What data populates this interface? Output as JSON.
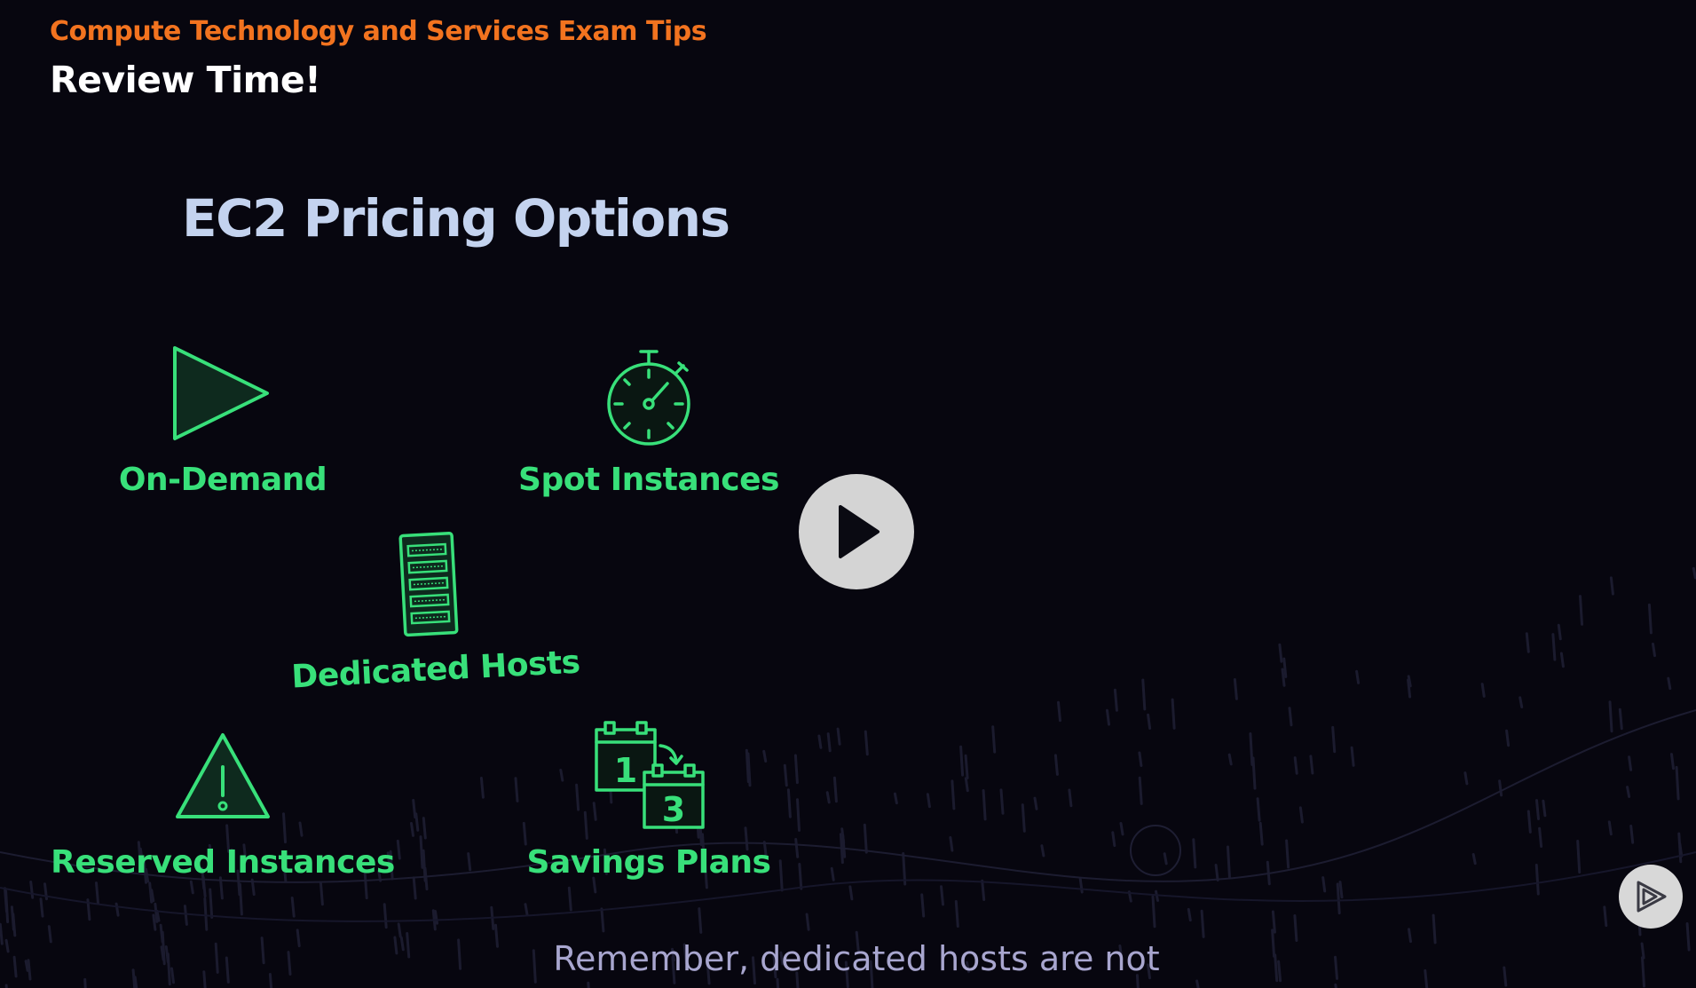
{
  "header": {
    "eyebrow": "Compute Technology and Services Exam Tips",
    "title": "Review Time!"
  },
  "slide": {
    "heading": "EC2 Pricing Options",
    "accent_color": "#38e07a",
    "options": [
      {
        "label": "On-Demand",
        "icon": "play-triangle-icon"
      },
      {
        "label": "Spot Instances",
        "icon": "stopwatch-icon"
      },
      {
        "label": "Dedicated Hosts",
        "icon": "server-rack-icon"
      },
      {
        "label": "Reserved Instances",
        "icon": "warning-triangle-icon"
      },
      {
        "label": "Savings Plans",
        "icon": "calendar-1-to-3-icon"
      }
    ],
    "calendar_numbers": [
      "1",
      "3"
    ]
  },
  "player": {
    "play_icon": "play-icon",
    "brand_icon": "pluralsight-logo-icon",
    "caption": "Remember, dedicated hosts are not"
  }
}
